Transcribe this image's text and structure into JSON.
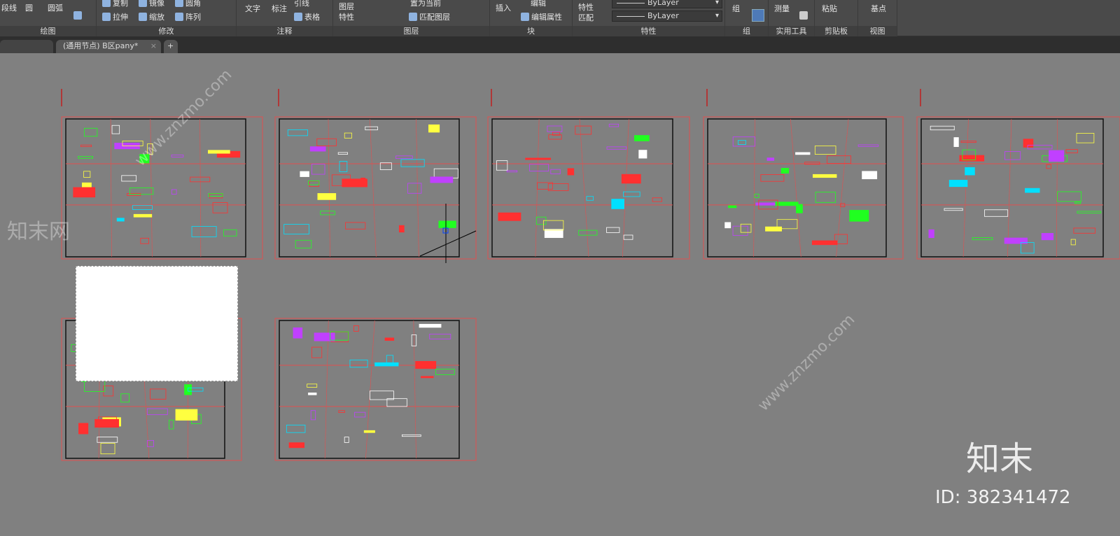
{
  "ribbon": {
    "draw": {
      "polyline": "段线",
      "circle": "圆",
      "arc": "圆弧",
      "title": "绘图"
    },
    "modify": {
      "copy": "复制",
      "mirror": "镜像",
      "fillet": "圆角",
      "stretch": "拉伸",
      "scale": "缩放",
      "array": "阵列",
      "title": "修改"
    },
    "annotation": {
      "text": "文字",
      "dimension": "标注",
      "leader": "引线",
      "table": "表格",
      "title": "注释"
    },
    "layers": {
      "layer_props": "图层\n特性",
      "set_current": "置为当前",
      "match_layer": "匹配图层",
      "title": "图层"
    },
    "block": {
      "insert": "插入",
      "edit": "编辑",
      "edit_attr": "编辑属性",
      "title": "块"
    },
    "properties": {
      "match": "特性\n匹配",
      "linetype": "ByLayer",
      "lineweight": "ByLayer",
      "title": "特性"
    },
    "groups": {
      "group": "组",
      "title": "组"
    },
    "utilities": {
      "measure": "测量",
      "title": "实用工具"
    },
    "clipboard": {
      "paste": "粘贴",
      "title": "剪贴板"
    },
    "view": {
      "base": "基点",
      "title": "视图"
    }
  },
  "tabs": [
    {
      "label": "(通用节点)   B区pany*",
      "active": true
    }
  ],
  "new_tab": "+",
  "watermark": {
    "site": "www.znzmo.com",
    "brand": "知末网",
    "logo": "知末",
    "id": "ID: 382341472"
  },
  "colors": {
    "canvas": "#808080",
    "sheet_border": "#e05050",
    "ribbon": "#4a4a4a"
  }
}
